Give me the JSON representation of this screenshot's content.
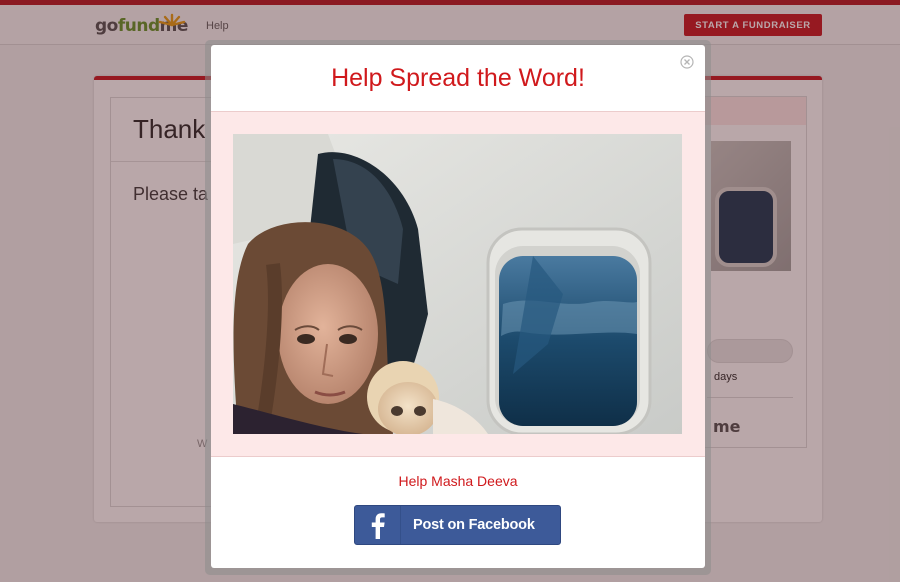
{
  "header": {
    "logo": {
      "part1": "go",
      "part2": "fund",
      "part3": "me"
    },
    "help_label": "Help",
    "cta_label": "START A FUNDRAISER"
  },
  "background": {
    "heading": "Thank",
    "body_text": "Please ta",
    "faint_text": "W",
    "side_days": "days",
    "side_logo": "me"
  },
  "modal": {
    "title": "Help Spread the Word!",
    "close_icon": "close-circle-icon",
    "photo_icon": "campaign-photo",
    "campaign_link": "Help Masha Deeva",
    "facebook_button": {
      "icon": "facebook-icon",
      "label": "Post on Facebook"
    }
  },
  "colors": {
    "brand_red": "#d0191c",
    "button_red": "#c8212b",
    "facebook_blue": "#3d5a99",
    "pink_band": "#fde8e8",
    "logo_green": "#6a9a33"
  }
}
